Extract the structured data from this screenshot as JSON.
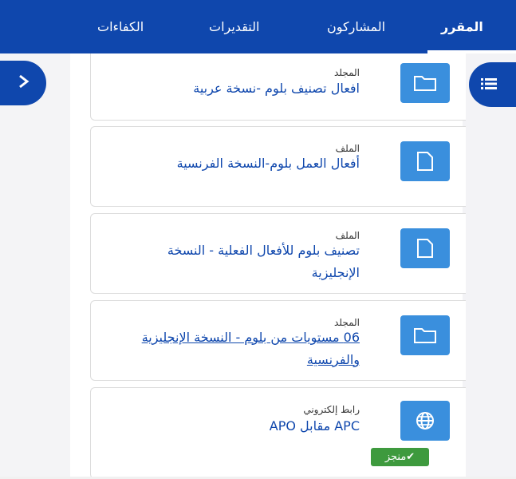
{
  "tabs": [
    {
      "label": "المقرر",
      "active": true
    },
    {
      "label": "المشاركون",
      "active": false
    },
    {
      "label": "التقديرات",
      "active": false
    },
    {
      "label": "الكفاءات",
      "active": false
    }
  ],
  "activities": [
    {
      "type": "المجلد",
      "name": "افعال تصنيف بلوم -نسخة عربية",
      "icon": "folder-icon"
    },
    {
      "type": "الملف",
      "name": "أفعال العمل بلوم-النسخة الفرنسية",
      "icon": "file-icon"
    },
    {
      "type": "الملف",
      "name": "تصنيف بلوم للأفعال الفعلية - النسخة الإنجليزية",
      "icon": "file-icon"
    },
    {
      "type": "المجلد",
      "name": "06 مستويات من بلوم - النسخة الإنجليزية والفرنسية",
      "icon": "folder-icon"
    },
    {
      "type": "رابط إلكتروني",
      "name": "APC مقابل APO",
      "icon": "globe-icon",
      "completion": "منجز"
    }
  ],
  "colors": {
    "brand": "#0f47ad",
    "icon_bg": "#3a8fdd",
    "done": "#3e9a3e"
  },
  "drawer_icons": {
    "left": "chevron-right-icon",
    "right": "list-icon"
  }
}
